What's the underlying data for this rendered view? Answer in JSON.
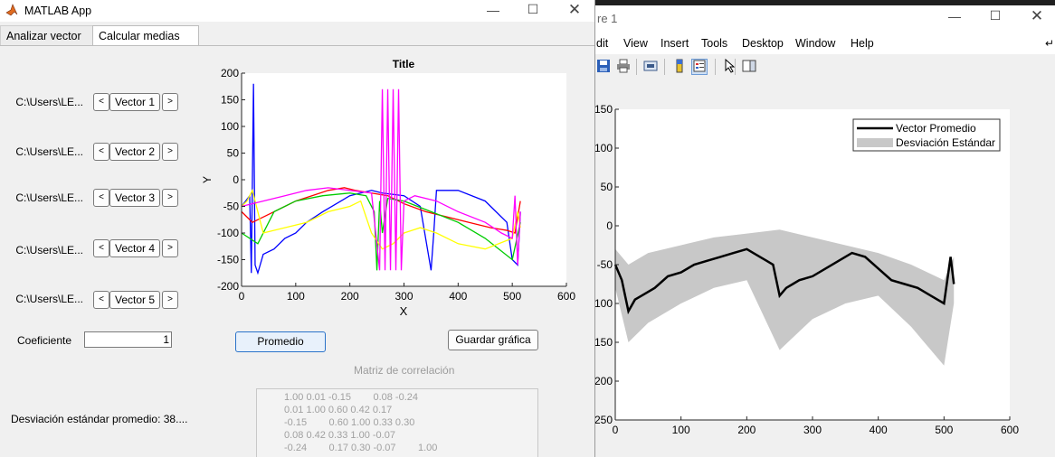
{
  "figure_window": {
    "title_fragment": "re 1",
    "menus": [
      "dit",
      "View",
      "Insert",
      "Tools",
      "Desktop",
      "Window",
      "Help"
    ],
    "toolbar_icons": [
      "save-icon",
      "print-icon",
      "link-icon",
      "colorbar-icon",
      "legend-icon",
      "pointer-icon",
      "property-icon"
    ],
    "chart_data": {
      "type": "area",
      "xlim": [
        0,
        600
      ],
      "ylim": [
        -250,
        150
      ],
      "x_ticks": [
        "0",
        "100",
        "200",
        "300",
        "400",
        "500",
        "600"
      ],
      "y_ticks": [
        "150",
        "100",
        "50",
        "0",
        "-50",
        "-100",
        "-150",
        "-200",
        "-250"
      ],
      "y_tick_values": [
        150,
        100,
        50,
        0,
        -50,
        -100,
        -150,
        -200,
        -250
      ],
      "legend": [
        "Vector Promedio",
        "Desviación Estándar"
      ],
      "legend_location": "top-right",
      "colors": {
        "mean": "#000000",
        "band": "#c8c8c8"
      },
      "series": [
        {
          "name": "Vector Promedio",
          "x": [
            0,
            10,
            20,
            30,
            40,
            60,
            80,
            100,
            120,
            140,
            160,
            180,
            200,
            220,
            230,
            240,
            250,
            260,
            270,
            280,
            300,
            320,
            340,
            360,
            380,
            400,
            420,
            440,
            460,
            480,
            500,
            510,
            515
          ],
          "y": [
            -50,
            -70,
            -110,
            -95,
            -90,
            -80,
            -65,
            -60,
            -50,
            -45,
            -40,
            -35,
            -30,
            -40,
            -45,
            -50,
            -90,
            -80,
            -75,
            -70,
            -65,
            -55,
            -45,
            -35,
            -40,
            -55,
            -70,
            -75,
            -80,
            -90,
            -100,
            -40,
            -75
          ]
        },
        {
          "name": "Desviación Estándar",
          "x": [
            0,
            20,
            50,
            100,
            150,
            200,
            250,
            300,
            350,
            400,
            450,
            500,
            515
          ],
          "upper": [
            -30,
            -50,
            -35,
            -25,
            -15,
            -10,
            -5,
            -15,
            -25,
            -35,
            -50,
            -70,
            -40
          ],
          "lower": [
            -80,
            -150,
            -125,
            -100,
            -80,
            -70,
            -160,
            -120,
            -100,
            -90,
            -130,
            -180,
            -100
          ]
        }
      ]
    }
  },
  "app": {
    "title": "MATLAB App",
    "tabs": [
      "Analizar vector",
      "Calcular medias"
    ],
    "vector_rows": [
      {
        "path": "C:\\Users\\LE...",
        "label": "Vector 1"
      },
      {
        "path": "C:\\Users\\LE...",
        "label": "Vector 2"
      },
      {
        "path": "C:\\Users\\LE...",
        "label": "Vector 3"
      },
      {
        "path": "C:\\Users\\LE...",
        "label": "Vector 4"
      },
      {
        "path": "C:\\Users\\LE...",
        "label": "Vector 5"
      }
    ],
    "prev_label": "<",
    "next_label": ">",
    "coef_label": "Coeficiente",
    "coef_value": "1",
    "promedio_label": "Promedio",
    "guardar_label": "Guardar gráfica",
    "corr_label": "Matriz de correlación",
    "corr_rows": [
      "1.00 0.01 -0.15        0.08 -0.24",
      "0.01 1.00 0.60 0.42 0.17",
      "-0.15        0.60 1.00 0.33 0.30",
      "0.08 0.42 0.33 1.00 -0.07",
      "-0.24        0.17 0.30 -0.07        1.00"
    ],
    "desv_label": "Desviación estándar promedio: 38....",
    "chart_data": {
      "type": "line",
      "title": "Title",
      "xlabel": "X",
      "ylabel": "Y",
      "xlim": [
        0,
        600
      ],
      "ylim": [
        -200,
        200
      ],
      "x_ticks": [
        "0",
        "100",
        "200",
        "300",
        "400",
        "500",
        "600"
      ],
      "y_ticks": [
        "200",
        "150",
        "100",
        "50",
        "0",
        "-50",
        "-100",
        "-150",
        "-200"
      ],
      "y_tick_values": [
        200,
        150,
        100,
        50,
        0,
        -50,
        -100,
        -150,
        -200
      ],
      "series": [
        {
          "color": "#0000ff",
          "x": [
            0,
            15,
            18,
            22,
            25,
            30,
            40,
            60,
            80,
            100,
            120,
            150,
            200,
            240,
            260,
            300,
            330,
            350,
            355,
            360,
            400,
            450,
            490,
            500,
            510,
            515
          ],
          "y": [
            -50,
            -30,
            -175,
            180,
            -160,
            -175,
            -140,
            -130,
            -110,
            -100,
            -80,
            -60,
            -30,
            -20,
            -25,
            -30,
            -50,
            -170,
            -100,
            -20,
            -20,
            -40,
            -80,
            -150,
            -160,
            -60
          ]
        },
        {
          "color": "#ff0000",
          "x": [
            0,
            20,
            40,
            60,
            80,
            100,
            130,
            160,
            190,
            210,
            240,
            270,
            300,
            340,
            380,
            420,
            460,
            490,
            505,
            515
          ],
          "y": [
            -60,
            -80,
            -70,
            -60,
            -50,
            -40,
            -30,
            -20,
            -15,
            -20,
            -25,
            -30,
            -45,
            -60,
            -70,
            -80,
            -90,
            -95,
            -100,
            -40
          ]
        },
        {
          "color": "#00cc00",
          "x": [
            0,
            30,
            60,
            100,
            150,
            200,
            230,
            245,
            250,
            255,
            260,
            270,
            300,
            350,
            400,
            450,
            500,
            515
          ],
          "y": [
            -100,
            -120,
            -60,
            -40,
            -30,
            -25,
            -30,
            -60,
            -170,
            -40,
            -100,
            -35,
            -40,
            -60,
            -80,
            -110,
            -150,
            -80
          ]
        },
        {
          "color": "#ffff00",
          "x": [
            0,
            10,
            20,
            40,
            80,
            120,
            160,
            200,
            220,
            240,
            260,
            280,
            300,
            330,
            360,
            400,
            450,
            500,
            510,
            515
          ],
          "y": [
            -50,
            -40,
            -20,
            -100,
            -90,
            -80,
            -60,
            -50,
            -40,
            -100,
            -130,
            -120,
            -100,
            -90,
            -100,
            -120,
            -130,
            -110,
            -60,
            -90
          ]
        },
        {
          "color": "#ff00ff",
          "x": [
            0,
            40,
            80,
            120,
            160,
            200,
            240,
            255,
            260,
            265,
            270,
            275,
            280,
            285,
            290,
            295,
            300,
            320,
            360,
            400,
            450,
            480,
            500,
            505,
            510,
            515
          ],
          "y": [
            -50,
            -40,
            -30,
            -20,
            -15,
            -20,
            -25,
            -170,
            170,
            -170,
            170,
            -170,
            170,
            -170,
            170,
            -170,
            -40,
            -30,
            -40,
            -60,
            -80,
            -100,
            -110,
            -30,
            -160,
            -60
          ]
        }
      ]
    }
  }
}
